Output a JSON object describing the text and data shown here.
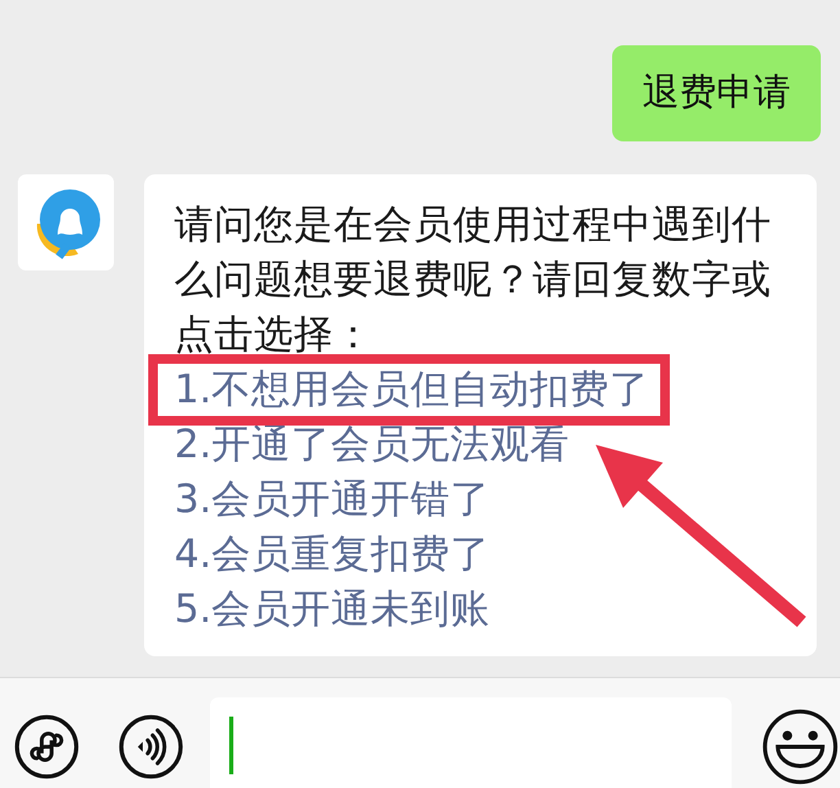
{
  "messages": [
    {
      "kind": "outgoing",
      "text": "退费申请"
    },
    {
      "kind": "incoming",
      "text": "请问您是在会员使用过程中遇到什么问题想要退费呢？请回复数字或点击选择：",
      "options": [
        {
          "text": "1.不想用会员但自动扣费了",
          "highlighted": true
        },
        {
          "text": "2.开通了会员无法观看",
          "highlighted": false
        },
        {
          "text": "3.会员开通开错了",
          "highlighted": false
        },
        {
          "text": "4.会员重复扣费了",
          "highlighted": false
        },
        {
          "text": "5.会员开通未到账",
          "highlighted": false
        }
      ]
    }
  ],
  "input": {
    "focused": true
  }
}
